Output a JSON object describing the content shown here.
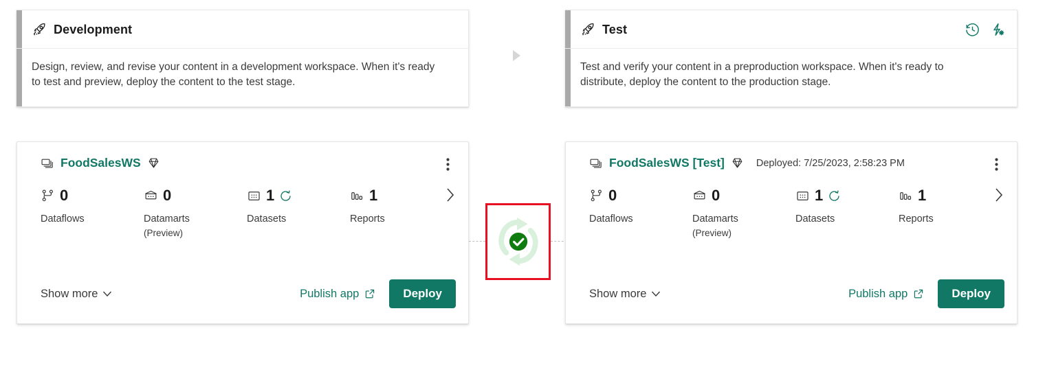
{
  "stages": [
    {
      "id": "development",
      "icon": "rocket-icon",
      "title": "Development",
      "description": "Design, review, and revise your content in a development workspace. When it's ready to test and preview, deploy the content to the test stage.",
      "header_actions": []
    },
    {
      "id": "test",
      "icon": "rocket-icon",
      "title": "Test",
      "description": "Test and verify your content in a preproduction workspace. When it's ready to distribute, deploy the content to the production stage.",
      "header_actions": [
        {
          "name": "deployment-history-icon",
          "label": "Deployment history"
        },
        {
          "name": "deployment-rules-icon",
          "label": "Deployment rules"
        }
      ]
    }
  ],
  "workspaces": [
    {
      "id": "development",
      "workspace_icon": "workspace-icon",
      "name": "FoodSalesWS",
      "capacity_icon": "premium-diamond-icon",
      "deployed_text": "",
      "menu_label": "More options",
      "items": [
        {
          "icon": "dataflows-icon",
          "count": "0",
          "label": "Dataflows",
          "sublabel": "",
          "refresh": false
        },
        {
          "icon": "datamarts-icon",
          "count": "0",
          "label": "Datamarts",
          "sublabel": "(Preview)",
          "refresh": false
        },
        {
          "icon": "datasets-icon",
          "count": "1",
          "label": "Datasets",
          "sublabel": "",
          "refresh": true
        },
        {
          "icon": "reports-icon",
          "count": "1",
          "label": "Reports",
          "sublabel": "",
          "refresh": false
        }
      ],
      "show_more_label": "Show more",
      "publish_label": "Publish app",
      "deploy_label": "Deploy"
    },
    {
      "id": "test",
      "workspace_icon": "workspace-icon",
      "name": "FoodSalesWS [Test]",
      "capacity_icon": "premium-diamond-icon",
      "deployed_text": "Deployed: 7/25/2023, 2:58:23 PM",
      "menu_label": "More options",
      "items": [
        {
          "icon": "dataflows-icon",
          "count": "0",
          "label": "Dataflows",
          "sublabel": "",
          "refresh": false
        },
        {
          "icon": "datamarts-icon",
          "count": "0",
          "label": "Datamarts",
          "sublabel": "(Preview)",
          "refresh": false
        },
        {
          "icon": "datasets-icon",
          "count": "1",
          "label": "Datasets",
          "sublabel": "",
          "refresh": true
        },
        {
          "icon": "reports-icon",
          "count": "1",
          "label": "Reports",
          "sublabel": "",
          "refresh": false
        }
      ],
      "show_more_label": "Show more",
      "publish_label": "Publish app",
      "deploy_label": "Deploy"
    }
  ],
  "compare_indicator": {
    "name": "stages-in-sync-icon",
    "status": "success",
    "highlight_color": "#e81123",
    "ring_color": "#d9f0dd",
    "check_color": "#107c10"
  },
  "colors": {
    "accent_teal": "#117865",
    "stage_accent_bar": "#a9a9a9",
    "text_primary": "#1b1b1b",
    "text_secondary": "#3b3b3b",
    "card_border": "#e6e6e6",
    "annotation_red": "#e81123"
  }
}
